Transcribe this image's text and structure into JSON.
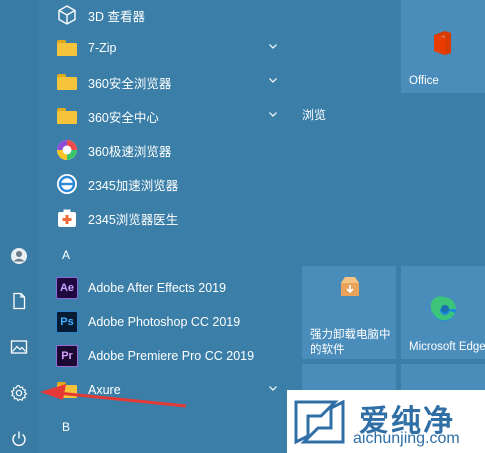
{
  "app_list": {
    "items": [
      {
        "label": "3D 查看器",
        "icon": "cube-icon"
      },
      {
        "label": "7-Zip",
        "icon": "folder-icon",
        "expandable": true
      },
      {
        "label": "360安全浏览器",
        "icon": "folder-icon",
        "expandable": true
      },
      {
        "label": "360安全中心",
        "icon": "folder-icon",
        "expandable": true
      },
      {
        "label": "360极速浏览器",
        "icon": "360-speed-browser-icon"
      },
      {
        "label": "2345加速浏览器",
        "icon": "2345-browser-icon"
      },
      {
        "label": "2345浏览器医生",
        "icon": "medical-kit-icon"
      }
    ],
    "section_a": "A",
    "a_items": [
      {
        "label": "Adobe After Effects 2019",
        "badge": "Ae"
      },
      {
        "label": "Adobe Photoshop CC 2019",
        "badge": "Ps"
      },
      {
        "label": "Adobe Premiere Pro CC 2019",
        "badge": "Pr"
      },
      {
        "label": "Axure",
        "icon": "folder-icon",
        "expandable": true
      }
    ],
    "section_b": "B"
  },
  "tiles": {
    "office": {
      "label": "Office"
    },
    "group_title": "浏览",
    "uninstall": {
      "label_line1": "强力卸载电脑中",
      "label_line2": "的软件"
    },
    "edge": {
      "label": "Microsoft Edge"
    }
  },
  "watermark": {
    "cn": "爱纯净",
    "en": "aichunjing.com"
  },
  "colors": {
    "background": "#3b7fa8",
    "tile": "#4a8dbb",
    "arrow": "#e53935"
  }
}
